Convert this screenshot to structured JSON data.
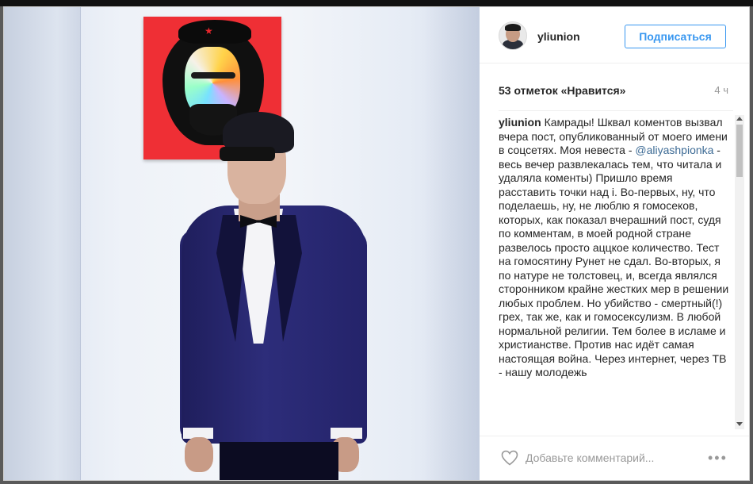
{
  "post": {
    "username": "yliunion",
    "follow_label": "Подписаться",
    "likes_text": "53 отметок «Нравится»",
    "time_ago": "4 ч",
    "caption_username": "yliunion",
    "caption_part1": "Камрады! Шквал коментов вызвал вчера пост, опубликованный от моего имени в соцсетях. Моя невеста - ",
    "mention": "@aliyashpionka",
    "caption_part2": " - весь вечер развлекалась тем, что читала и удаляла коменты) Пришло время расставить точки над i. Во-первых, ну, что поделаешь, ну, не люблю я гомосеков, которых, как показал вчерашний пост, судя по комментам, в моей родной стране развелось просто аццкое количество. Тест на гомосятину Рунет не сдал. Во-вторых, я по натуре не толстовец, и, всегда являлся сторонником крайне жестких мер в решении любых проблем. Но убийство - смертный(!) грех, так же, как и гомосексулизм. В любой нормальной религии. Тем более в исламе и христианстве. Против нас идёт самая настоящая война. Через интернет, через ТВ - нашу молодежь",
    "comment_placeholder": "Добавьте комментарий...",
    "more_label": "•••"
  },
  "icons": {
    "heart": "heart-icon",
    "more": "more-options-icon",
    "avatar": "avatar"
  },
  "colors": {
    "accent": "#3897f0",
    "mention": "#3d6b95",
    "poster_red": "#ef2f35"
  }
}
